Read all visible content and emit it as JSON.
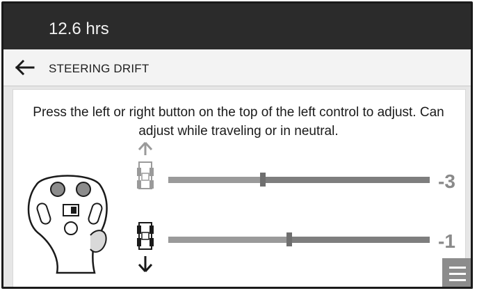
{
  "header": {
    "hours": "12.6 hrs"
  },
  "subheader": {
    "back_icon": "arrow-left-icon",
    "title": "STEERING DRIFT"
  },
  "instructions": {
    "text": "Press the left or right button on the top of the left control to adjust. Can adjust while traveling or in neutral."
  },
  "forward": {
    "icon": "tractor-forward-icon",
    "direction_icon": "arrow-up-icon",
    "value": "-3",
    "level": 0.36
  },
  "reverse": {
    "icon": "tractor-reverse-icon",
    "direction_icon": "arrow-down-icon",
    "value": "-1",
    "level": 0.46
  },
  "menu": {
    "icon": "hamburger-menu-icon"
  },
  "colors": {
    "header_bg": "#2b2b2b",
    "active_icon": "#1a1a1a",
    "inactive_icon": "#9a9a9a",
    "track": "#7e7e7e"
  }
}
